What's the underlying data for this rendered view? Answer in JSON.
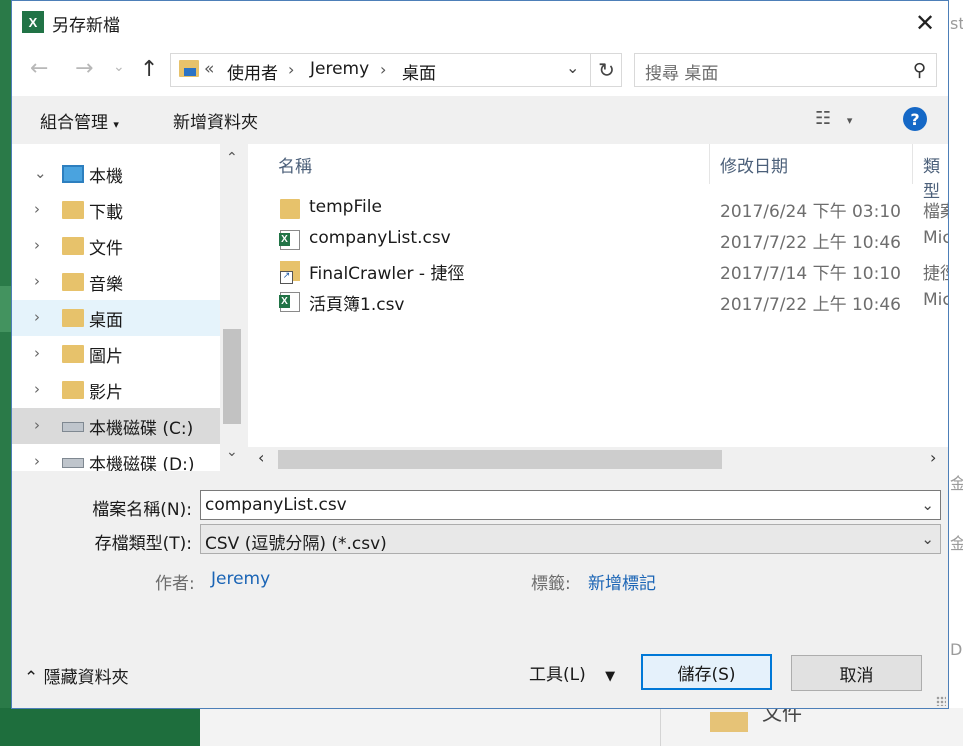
{
  "background": {
    "folder_label": "文件",
    "right_edge_texts": [
      "st",
      "金",
      "金",
      "Do"
    ]
  },
  "dialog": {
    "title": "另存新檔",
    "app_icon": "excel-icon"
  },
  "nav": {
    "breadcrumb": {
      "overflow": "«",
      "items": [
        "使用者",
        "Jeremy",
        "桌面"
      ]
    },
    "search_placeholder": "搜尋 桌面"
  },
  "toolbar": {
    "organize_label": "組合管理",
    "new_folder_label": "新增資料夾"
  },
  "sidebar": {
    "items": [
      {
        "label": "本機",
        "icon": "computer-icon",
        "expanded": true
      },
      {
        "label": "下載",
        "icon": "downloads-folder-icon"
      },
      {
        "label": "文件",
        "icon": "documents-folder-icon"
      },
      {
        "label": "音樂",
        "icon": "music-folder-icon"
      },
      {
        "label": "桌面",
        "icon": "desktop-folder-icon",
        "selected": true
      },
      {
        "label": "圖片",
        "icon": "pictures-folder-icon"
      },
      {
        "label": "影片",
        "icon": "videos-folder-icon"
      },
      {
        "label": "本機磁碟 (C:)",
        "icon": "drive-c-icon"
      },
      {
        "label": "本機磁碟 (D:)",
        "icon": "drive-d-icon"
      }
    ]
  },
  "file_list": {
    "columns": [
      "名稱",
      "修改日期",
      "類型"
    ],
    "rows": [
      {
        "name": "tempFile",
        "date": "2017/6/24 下午 03:10",
        "type": "檔案",
        "icon": "folder-icon"
      },
      {
        "name": "companyList.csv",
        "date": "2017/7/22 上午 10:46",
        "type": "Mic",
        "icon": "csv-file-icon"
      },
      {
        "name": "FinalCrawler - 捷徑",
        "date": "2017/7/14 下午 10:10",
        "type": "捷徑",
        "icon": "shortcut-icon"
      },
      {
        "name": "活頁簿1.csv",
        "date": "2017/7/22 上午 10:46",
        "type": "Mic",
        "icon": "csv-file-icon"
      }
    ]
  },
  "form": {
    "filename_label": "檔案名稱(N):",
    "filename_value": "companyList.csv",
    "filetype_label": "存檔類型(T):",
    "filetype_value": "CSV (逗號分隔) (*.csv)",
    "author_label": "作者:",
    "author_value": "Jeremy",
    "tags_label": "標籤:",
    "tags_value": "新增標記"
  },
  "footer": {
    "hide_folders_label": "隱藏資料夾",
    "tools_label": "工具(L)",
    "save_label": "儲存(S)",
    "cancel_label": "取消"
  },
  "colors": {
    "accent": "#0078d7",
    "excel_green": "#217346",
    "link_blue": "#1a64b5",
    "selected_bg": "#e5f3fb"
  }
}
